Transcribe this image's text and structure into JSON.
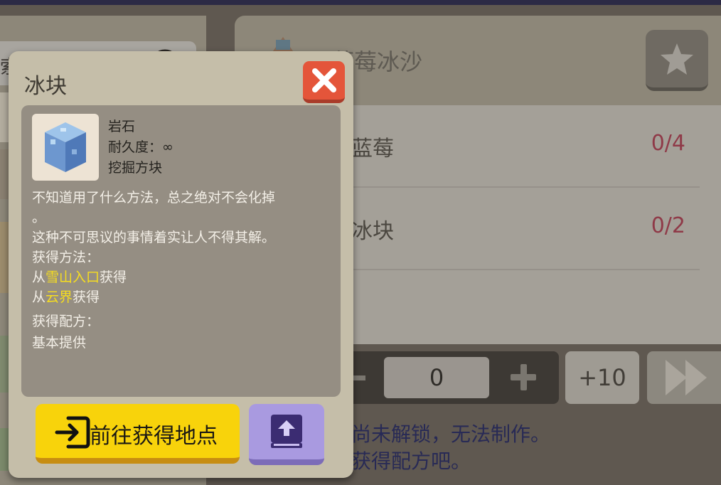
{
  "background": {
    "search": {
      "placeholder_fragment": "索内容"
    },
    "recipe": {
      "title": "蓝莓冰沙",
      "ingredients": [
        {
          "name": "蓝莓",
          "count": "0/4"
        },
        {
          "name": "冰块",
          "count": "0/2"
        }
      ],
      "quantity": "0",
      "plus10_label": "+10",
      "lock_message_line1": "尚未解锁，无法制作。",
      "lock_message_line2": "获得配方吧。"
    }
  },
  "modal": {
    "title": "冰块",
    "item": {
      "category": "岩石",
      "durability": "耐久度：∞",
      "tool": "挖掘方块"
    },
    "description_line1": "不知道用了什么方法，总之绝对不会化掉",
    "description_line2": "。",
    "description_line3": "这种不可思议的事情着实让人不得其解。",
    "obtain_heading": "获得方法：",
    "obtain_prefix": "从",
    "obtain_suffix": "获得",
    "sources": [
      "雪山入口",
      "云界"
    ],
    "recipe_heading": "获得配方：",
    "recipe_value": "基本提供",
    "goto_label": "前往获得地点"
  },
  "colors": {
    "highlight": "#f6dd1f",
    "close": "#e4553a",
    "goto": "#f8d30b",
    "book": "#a99ae0",
    "count": "#8f3a48"
  },
  "icons": [
    "search-icon",
    "star-icon",
    "close-icon",
    "ice-block-icon",
    "enter-icon",
    "book-upload-icon",
    "fast-forward-icon"
  ]
}
